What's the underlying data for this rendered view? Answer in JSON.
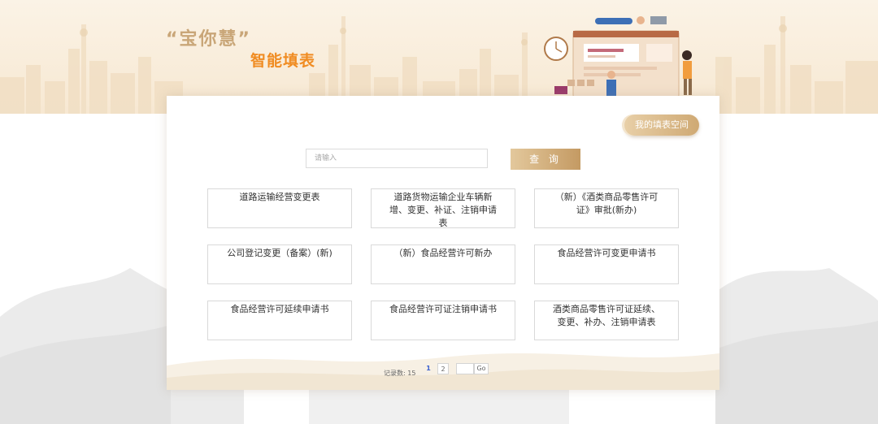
{
  "header": {
    "brand_quote": "“宝你慧”",
    "brand_title": "智能填表"
  },
  "card": {
    "space_button_label": "我的填表空间",
    "search": {
      "placeholder": "请输入",
      "value": ""
    },
    "query_button_label": "查 询",
    "forms": [
      "道路运输经营变更表",
      "道路货物运输企业车辆新增、变更、补证、注销申请表",
      "（新）《酒类商品零售许可证》审批(新办)",
      "公司登记变更（备案）(新)",
      "（新）食品经营许可新办",
      "食品经营许可变更申请书",
      "食品经营许可延续申请书",
      "食品经营许可证注销申请书",
      "酒类商品零售许可证延续、变更、补办、注销申请表"
    ]
  },
  "pager": {
    "record_label": "记录数: ",
    "record_count": "15",
    "pages": [
      "1",
      "2"
    ],
    "current_page": "1",
    "go_label": "Go"
  },
  "colors": {
    "accent_orange": "#f08c22",
    "accent_gold": "#c9a678",
    "button_gold": "#c49a63",
    "page_link_blue": "#3a5fd0"
  }
}
